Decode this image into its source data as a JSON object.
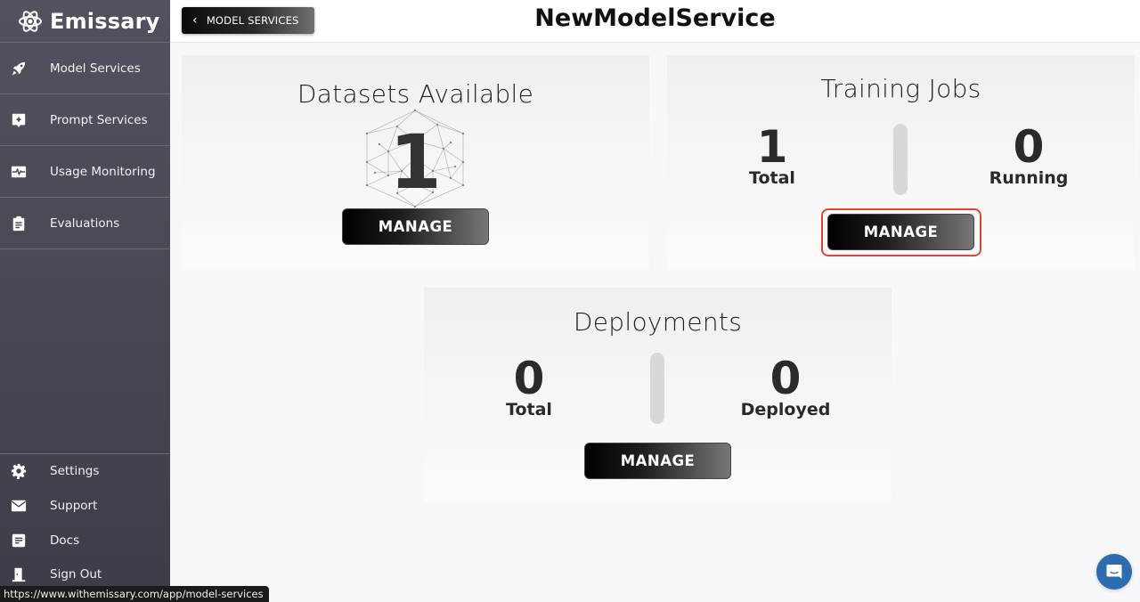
{
  "sidebar": {
    "brand": "Emissary",
    "top_items": [
      {
        "label": "Model Services",
        "icon": "rocket-icon"
      },
      {
        "label": "Prompt Services",
        "icon": "prompt-icon"
      },
      {
        "label": "Usage Monitoring",
        "icon": "monitor-icon"
      },
      {
        "label": "Evaluations",
        "icon": "clipboard-icon"
      }
    ],
    "bottom_items": [
      {
        "label": "Settings",
        "icon": "gear-icon"
      },
      {
        "label": "Support",
        "icon": "envelope-icon"
      },
      {
        "label": "Docs",
        "icon": "document-icon"
      },
      {
        "label": "Sign Out",
        "icon": "door-icon"
      }
    ]
  },
  "header": {
    "back_label": "MODEL SERVICES",
    "title": "NewModelService"
  },
  "datasets": {
    "title": "Datasets Available",
    "count": "1",
    "manage_label": "MANAGE"
  },
  "training": {
    "title": "Training Jobs",
    "total_value": "1",
    "total_label": "Total",
    "running_value": "0",
    "running_label": "Running",
    "manage_label": "MANAGE"
  },
  "deployments": {
    "title": "Deployments",
    "total_value": "0",
    "total_label": "Total",
    "deployed_value": "0",
    "deployed_label": "Deployed",
    "manage_label": "MANAGE"
  },
  "status_bar": {
    "url": "https://www.withemissary.com/app/model-services"
  },
  "colors": {
    "sidebar_bg": "#4a4b55",
    "focus_ring": "#e0452f",
    "chat_button": "#2d6cad"
  }
}
